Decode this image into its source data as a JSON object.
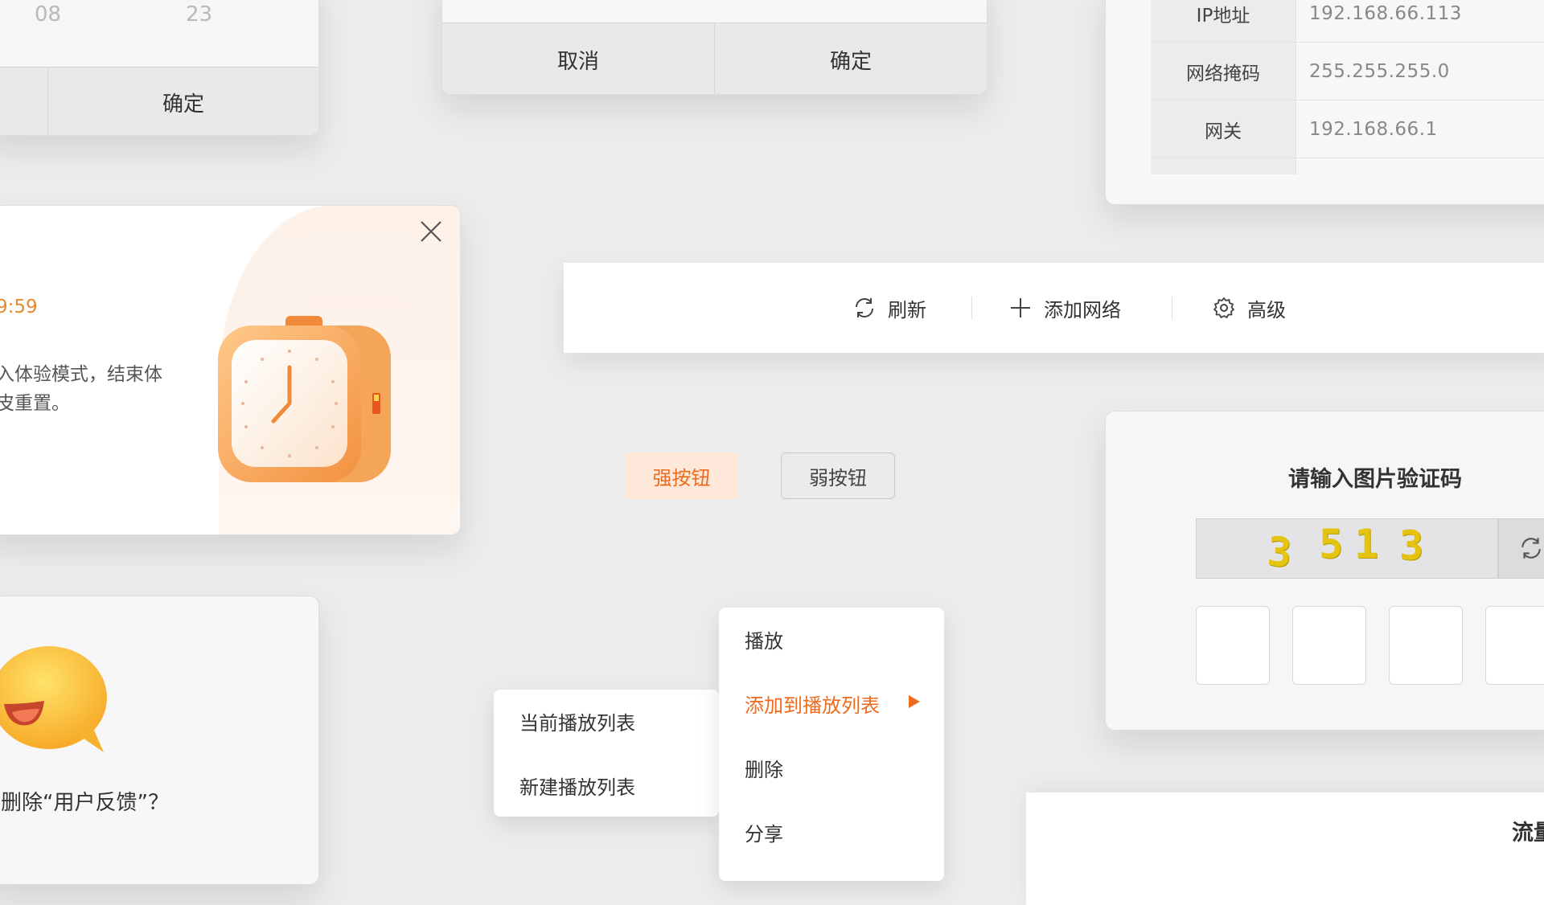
{
  "time_picker": {
    "hour": "08",
    "minute": "23",
    "confirm_label": "确定"
  },
  "confirm_dialog": {
    "cancel_label": "取消",
    "confirm_label": "确定"
  },
  "network_info": {
    "rows": [
      {
        "key": "IP地址",
        "value": "192.168.66.113"
      },
      {
        "key": "网络掩码",
        "value": "255.255.255.0"
      },
      {
        "key": "网关",
        "value": "192.168.66.1"
      }
    ]
  },
  "trial_dialog": {
    "countdown": "9:59",
    "line1": "入体验模式，结束体",
    "line2": "皮重置。"
  },
  "toolbar": {
    "refresh_label": "刷新",
    "add_network_label": "添加网络",
    "advanced_label": "高级"
  },
  "buttons": {
    "strong_label": "强按钮",
    "weak_label": "弱按钮"
  },
  "captcha": {
    "title": "请输入图片验证码",
    "digits": [
      "3",
      "5",
      "1",
      "3"
    ]
  },
  "feedback": {
    "prompt": "删除“用户反馈”？"
  },
  "context_menu": {
    "items": [
      "播放",
      "添加到播放列表",
      "删除",
      "分享"
    ],
    "submenu": [
      "当前播放列表",
      "新建播放列表"
    ]
  },
  "traffic_panel": {
    "label": "流量"
  },
  "colors": {
    "accent": "#ee6a1c",
    "accent_light": "#fde8d9",
    "background": "#ececec"
  }
}
